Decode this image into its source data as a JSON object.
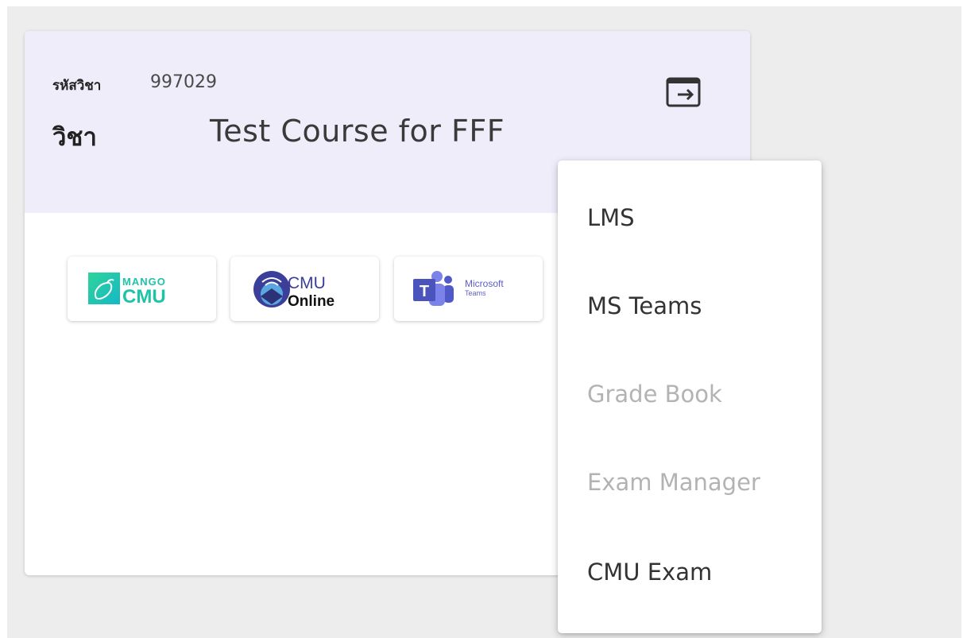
{
  "course": {
    "code_label": "รหัสวิชา",
    "code_value": "997029",
    "name_label": "วิชา",
    "name_value": "Test Course for FFF"
  },
  "apps": [
    {
      "name": "mango-cmu",
      "text_top": "MANGO",
      "text_bottom": "CMU",
      "color": "#1fc3a8"
    },
    {
      "name": "cmu-online",
      "text_top": "CMU",
      "text_bottom": "Online",
      "color": "#3b3f9a"
    },
    {
      "name": "microsoft-teams",
      "text_top": "Microsoft",
      "text_bottom": "Teams",
      "color": "#4f58b8"
    }
  ],
  "menu": {
    "items": [
      {
        "label": "LMS",
        "enabled": true
      },
      {
        "label": "MS Teams",
        "enabled": true
      },
      {
        "label": "Grade Book",
        "enabled": false
      },
      {
        "label": "Exam Manager",
        "enabled": false
      },
      {
        "label": "CMU Exam",
        "enabled": true
      }
    ]
  },
  "icons": {
    "exit": "exit-to-app-icon"
  }
}
